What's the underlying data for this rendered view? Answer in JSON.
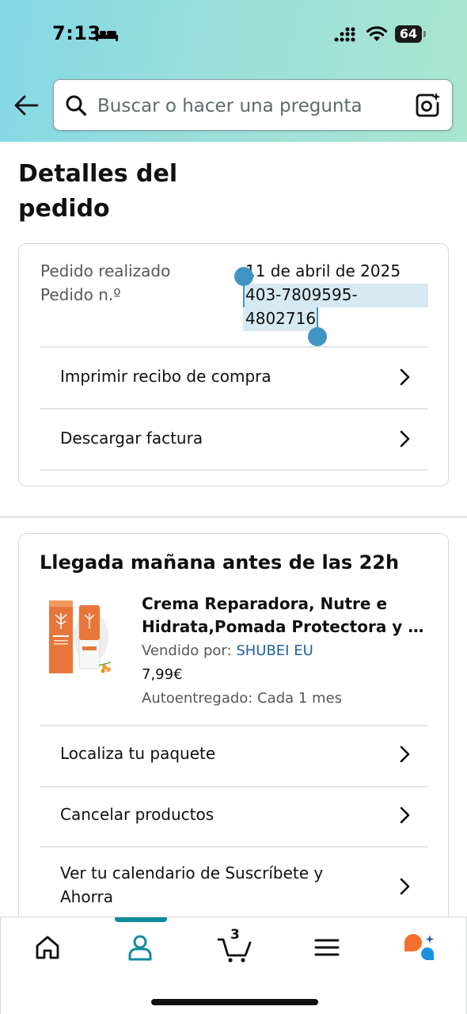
{
  "status_bar": {
    "time": "7:13",
    "battery": "64"
  },
  "header": {
    "search_placeholder": "Buscar o hacer una pregunta",
    "back_icon": "back-arrow-icon",
    "camera_icon": "camera-search-icon"
  },
  "page": {
    "title": "Detalles del pedido"
  },
  "order_info": {
    "placed_label": "Pedido realizado",
    "placed_value": "11 de abril de 2025",
    "number_label": "Pedido n.º",
    "number_value_line1": "403-7809595-",
    "number_value_line2": "4802716",
    "actions": [
      {
        "label": "Imprimir recibo de compra"
      },
      {
        "label": "Descargar factura"
      }
    ]
  },
  "shipment": {
    "title": "Llegada mañana antes de las 22h",
    "product": {
      "title_line1": "Crema Reparadora, Nutre e",
      "title_line2": "Hidrata,Pomada Protectora y Ci…",
      "sold_by_label": "Vendido por:",
      "seller": "SHUBEI EU",
      "price": "7,99€",
      "autoship": "Autoentregado: Cada 1 mes"
    },
    "actions": [
      {
        "label": "Localiza tu paquete"
      },
      {
        "label": "Cancelar productos"
      },
      {
        "label_line1": "Ver tu calendario de Suscríbete y",
        "label_line2": "Ahorra"
      }
    ]
  },
  "bottom_nav": {
    "items": [
      "home-icon",
      "account-icon",
      "cart-icon",
      "menu-icon",
      "rufus-assistant-icon"
    ],
    "active": "account-icon",
    "cart_count": "3"
  },
  "colors": {
    "accent": "#138a9e",
    "link": "#2162a1",
    "selection": "#d7eaf3",
    "selection_handle": "#3f95c6"
  }
}
